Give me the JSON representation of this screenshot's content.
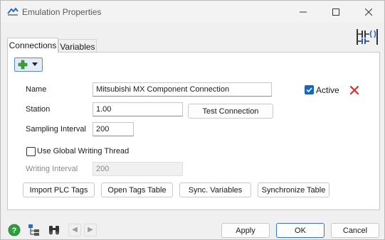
{
  "window": {
    "title": "Emulation Properties",
    "minimize_icon": "minimize-icon",
    "maximize_icon": "maximize-icon",
    "close_icon": "close-icon"
  },
  "tabs": [
    {
      "label": "Connections",
      "selected": true
    },
    {
      "label": "Variables",
      "selected": false
    }
  ],
  "toolbar": {
    "add_icon": "green-plus-icon",
    "dropdown_icon": "caret-down-icon"
  },
  "connection": {
    "name_label": "Name",
    "name_value": "Mitsubishi MX Component Connection",
    "active_label": "Active",
    "active_checked": true,
    "delete_icon": "red-x-icon",
    "station_label": "Station",
    "station_value": "1.00",
    "test_button": "Test Connection",
    "sampling_label": "Sampling Interval",
    "sampling_value": "200",
    "global_thread_label": "Use Global Writing Thread",
    "global_thread_checked": false,
    "writing_label": "Writing Interval",
    "writing_value": "200"
  },
  "actions": {
    "import_tags": "Import PLC Tags",
    "open_tags": "Open Tags Table",
    "sync_variables": "Sync. Variables",
    "sync_table": "Synchronize Table"
  },
  "footer": {
    "apply": "Apply",
    "ok": "OK",
    "cancel": "Cancel",
    "help_icon": "help-icon",
    "tree_icon": "tree-icon",
    "binoculars_icon": "binoculars-icon",
    "prev_icon": "left-arrow-icon",
    "next_icon": "right-arrow-icon"
  },
  "colors": {
    "accent": "#1e64b6",
    "delete": "#d9342b",
    "add": "#3aa53a",
    "help": "#2e9e3e"
  }
}
